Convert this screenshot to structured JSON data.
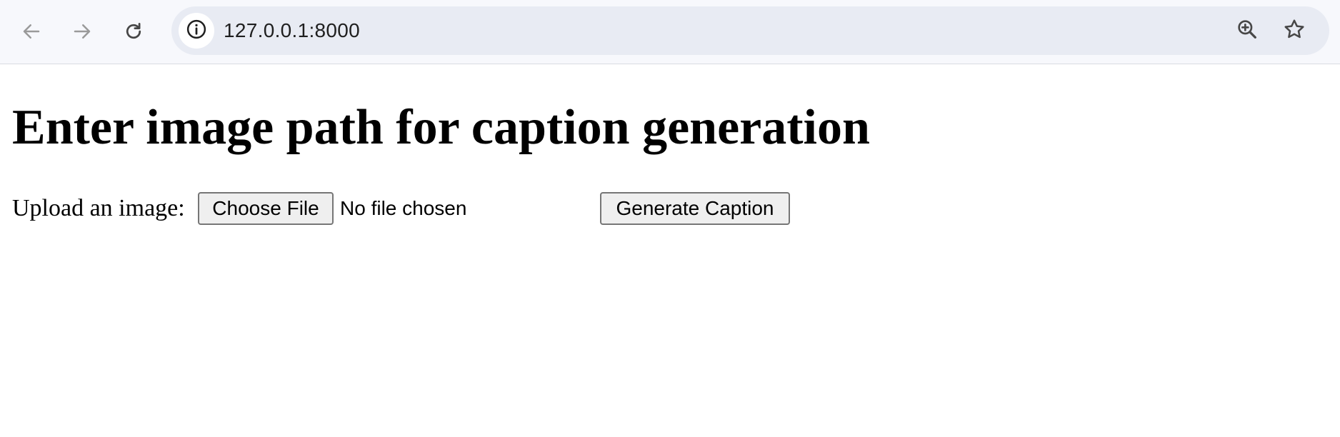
{
  "browser": {
    "url": "127.0.0.1:8000",
    "icons": {
      "back": "arrow-left-icon",
      "forward": "arrow-right-icon",
      "reload": "reload-icon",
      "site_info": "info-icon",
      "zoom": "zoom-in-icon",
      "bookmark": "star-icon"
    }
  },
  "page": {
    "heading": "Enter image path for caption generation",
    "form": {
      "upload_label": "Upload an image:",
      "choose_file_label": "Choose File",
      "file_status": "No file chosen",
      "submit_label": "Generate Caption"
    }
  },
  "colors": {
    "toolbar_bg": "#f7f8fc",
    "omnibox_bg": "#e8ebf3",
    "button_bg": "#efefef",
    "button_border": "#767676"
  }
}
